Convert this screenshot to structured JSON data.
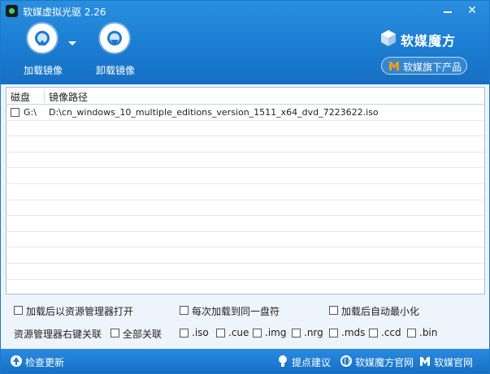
{
  "window": {
    "title": "软媒虚拟光驱 2.26"
  },
  "toolbar": {
    "mount_label": "加载镜像",
    "unmount_label": "卸载镜像"
  },
  "brand": {
    "name": "软媒魔方",
    "products_label": "软媒旗下产品"
  },
  "table": {
    "headers": {
      "drive": "磁盘",
      "path": "镜像路径"
    },
    "rows": [
      {
        "drive": "G:\\",
        "path": "D:\\cn_windows_10_multiple_editions_version_1511_x64_dvd_7223622.iso",
        "checked": false
      }
    ],
    "empty_row_count": 11
  },
  "options": {
    "open_explorer_after_mount": {
      "label": "加载后以资源管理器打开",
      "checked": false
    },
    "mount_same_drive": {
      "label": "每次加载到同一盘符",
      "checked": false
    },
    "minimize_after_mount": {
      "label": "加载后自动最小化",
      "checked": false
    },
    "context_menu_label": "资源管理器右键关联",
    "associate_all": {
      "label": "全部关联",
      "checked": false
    },
    "extensions": [
      {
        "label": ".iso",
        "checked": false
      },
      {
        "label": ".cue",
        "checked": false
      },
      {
        "label": ".img",
        "checked": false
      },
      {
        "label": ".nrg",
        "checked": false
      },
      {
        "label": ".mds",
        "checked": false
      },
      {
        "label": ".ccd",
        "checked": false
      },
      {
        "label": ".bin",
        "checked": false
      }
    ]
  },
  "footer": {
    "check_update": "检查更新",
    "feedback": "提点建议",
    "mofang_site": "软媒魔方官网",
    "ruanmei_site": "软媒官网"
  },
  "colors": {
    "header_blue": "#1a7bd0",
    "footer_blue": "#1670c4",
    "accent_orange": "#f29a1b"
  },
  "icons": {
    "app": "app-disc-icon",
    "mount": "disc-mount-icon",
    "unmount": "disc-unmount-icon",
    "brand": "cube-logo-icon",
    "products": "m-logo-icon",
    "update": "arrow-up-circle-icon",
    "feedback": "lightbulb-icon",
    "mofang_site": "globe-icon",
    "ruanmei_site": "m-logo-icon"
  }
}
